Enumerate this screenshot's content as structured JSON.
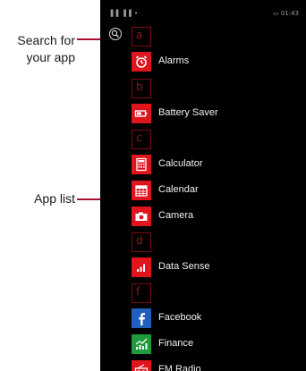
{
  "callouts": {
    "search": {
      "line1": "Search for",
      "line2": "your app"
    },
    "list": "App list"
  },
  "status_bar": {
    "left": "▐▐ ▐▐ •",
    "right": "▭ 01:43"
  },
  "apps": [
    {
      "type": "letter",
      "letter": "a"
    },
    {
      "type": "app",
      "label": "Alarms",
      "icon": "alarm-clock-icon",
      "color": "#e0141d"
    },
    {
      "type": "letter",
      "letter": "b"
    },
    {
      "type": "app",
      "label": "Battery Saver",
      "icon": "battery-icon",
      "color": "#e0141d"
    },
    {
      "type": "letter",
      "letter": "c"
    },
    {
      "type": "app",
      "label": "Calculator",
      "icon": "calculator-icon",
      "color": "#e0141d"
    },
    {
      "type": "app",
      "label": "Calendar",
      "icon": "calendar-icon",
      "color": "#e0141d"
    },
    {
      "type": "app",
      "label": "Camera",
      "icon": "camera-icon",
      "color": "#e0141d"
    },
    {
      "type": "letter",
      "letter": "d"
    },
    {
      "type": "app",
      "label": "Data Sense",
      "icon": "bar-chart-icon",
      "color": "#e0141d"
    },
    {
      "type": "letter",
      "letter": "f"
    },
    {
      "type": "app",
      "label": "Facebook",
      "icon": "facebook-icon",
      "color": "#1f5fbf"
    },
    {
      "type": "app",
      "label": "Finance",
      "icon": "finance-chart-icon",
      "color": "#1e9a3a"
    },
    {
      "type": "app",
      "label": "FM Radio",
      "icon": "radio-icon",
      "color": "#e0141d"
    }
  ],
  "colors": {
    "accent": "#e0141d",
    "callout": "#a8102e",
    "letter_border": "#7a0e12"
  }
}
